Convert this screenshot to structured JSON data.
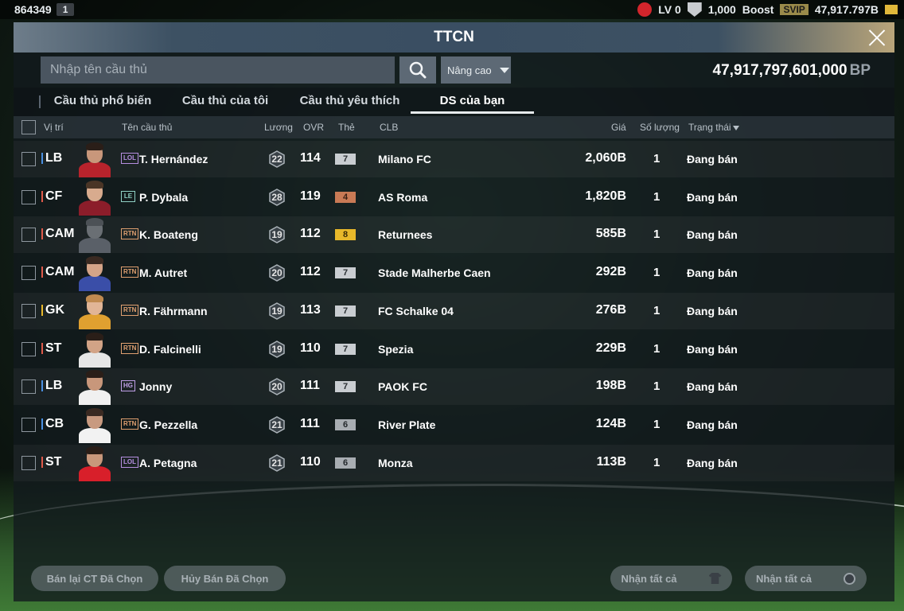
{
  "topbar": {
    "user_id": "864349",
    "badge": "1",
    "level": "LV 0",
    "trophy_value": "1,000",
    "boost_label": "Boost",
    "svip_label": "SVIP",
    "bp_short": "47,917.797B",
    "accent_red": "#d2252c",
    "coin_color": "#e0b83a"
  },
  "window": {
    "title": "TTCN"
  },
  "search": {
    "placeholder": "Nhập tên cầu thủ",
    "value": "",
    "advanced_label": "Nâng cao"
  },
  "balance": {
    "amount": "47,917,797,601,000",
    "unit": "BP"
  },
  "tabs": [
    {
      "label": "Cầu thủ phổ biến",
      "active": false
    },
    {
      "label": "Cầu thủ của tôi",
      "active": false
    },
    {
      "label": "Cầu thủ yêu thích",
      "active": false
    },
    {
      "label": "DS của bạn",
      "active": true
    }
  ],
  "table": {
    "headers": {
      "position": "Vị trí",
      "name": "Tên cầu thủ",
      "salary": "Lương",
      "ovr": "OVR",
      "grade": "Thẻ",
      "club": "CLB",
      "price": "Giá",
      "qty": "Số lượng",
      "status": "Trạng thái"
    },
    "rows": [
      {
        "pos": "LB",
        "pos_color": "#4a90e2",
        "season": "LOL",
        "season_color": "#b58ee0",
        "name": "T. Hernández",
        "salary": "22",
        "ovr": "114",
        "grade": "7",
        "grade_bg": "#c9cdd1",
        "grade_fg": "#2a2f33",
        "club": "Milano FC",
        "price": "2,060B",
        "qty": "1",
        "status": "Đang bán",
        "kit": "#b8232c",
        "skin": "#c8977b",
        "hair": "#2a1e18"
      },
      {
        "pos": "CF",
        "pos_color": "#e05a4a",
        "season": "LE",
        "season_color": "#8fd0c4",
        "name": "P. Dybala",
        "salary": "28",
        "ovr": "119",
        "grade": "4",
        "grade_bg": "#c97a55",
        "grade_fg": "#3b2014",
        "club": "AS Roma",
        "price": "1,820B",
        "qty": "1",
        "status": "Đang bán",
        "kit": "#8c1d2a",
        "skin": "#d8ab8e",
        "hair": "#4a3526"
      },
      {
        "pos": "CAM",
        "pos_color": "#e05a4a",
        "season": "RTN",
        "season_color": "#e0a070",
        "name": "K. Boateng",
        "salary": "19",
        "ovr": "112",
        "grade": "8",
        "grade_bg": "#e8b82a",
        "grade_fg": "#3a2a05",
        "club": "Returnees",
        "price": "585B",
        "qty": "1",
        "status": "Đang bán",
        "kit": "#5a6068",
        "skin": "#6a6f74",
        "hair": "#4c5156"
      },
      {
        "pos": "CAM",
        "pos_color": "#e05a4a",
        "season": "RTN",
        "season_color": "#e0a070",
        "name": "M. Autret",
        "salary": "20",
        "ovr": "112",
        "grade": "7",
        "grade_bg": "#c9cdd1",
        "grade_fg": "#2a2f33",
        "club": "Stade Malherbe Caen",
        "price": "292B",
        "qty": "1",
        "status": "Đang bán",
        "kit": "#3a4ea8",
        "skin": "#d4a488",
        "hair": "#3a2a22"
      },
      {
        "pos": "GK",
        "pos_color": "#e8b82a",
        "season": "RTN",
        "season_color": "#e0a070",
        "name": "R. Fährmann",
        "salary": "19",
        "ovr": "113",
        "grade": "7",
        "grade_bg": "#c9cdd1",
        "grade_fg": "#2a2f33",
        "club": "FC Schalke 04",
        "price": "276B",
        "qty": "1",
        "status": "Đang bán",
        "kit": "#e0a030",
        "skin": "#e1b596",
        "hair": "#c08a50"
      },
      {
        "pos": "ST",
        "pos_color": "#e05a4a",
        "season": "RTN",
        "season_color": "#e0a070",
        "name": "D. Falcinelli",
        "salary": "19",
        "ovr": "110",
        "grade": "7",
        "grade_bg": "#c9cdd1",
        "grade_fg": "#2a2f33",
        "club": "Spezia",
        "price": "229B",
        "qty": "1",
        "status": "Đang bán",
        "kit": "#e6e6e6",
        "skin": "#d2a386",
        "hair": "#2a1e18"
      },
      {
        "pos": "LB",
        "pos_color": "#4a90e2",
        "season": "HG",
        "season_color": "#c0a0e8",
        "name": "Jonny",
        "salary": "20",
        "ovr": "111",
        "grade": "7",
        "grade_bg": "#c9cdd1",
        "grade_fg": "#2a2f33",
        "club": "PAOK FC",
        "price": "198B",
        "qty": "1",
        "status": "Đang bán",
        "kit": "#f0f0f0",
        "skin": "#c8977b",
        "hair": "#2a1e18"
      },
      {
        "pos": "CB",
        "pos_color": "#4a90e2",
        "season": "RTN",
        "season_color": "#e0a070",
        "name": "G. Pezzella",
        "salary": "21",
        "ovr": "111",
        "grade": "6",
        "grade_bg": "#a8adb2",
        "grade_fg": "#23282c",
        "club": "River Plate",
        "price": "124B",
        "qty": "1",
        "status": "Đang bán",
        "kit": "#f2f2f2",
        "skin": "#c89a80",
        "hair": "#3a2a22"
      },
      {
        "pos": "ST",
        "pos_color": "#e05a4a",
        "season": "LOL",
        "season_color": "#b58ee0",
        "name": "A. Petagna",
        "salary": "21",
        "ovr": "110",
        "grade": "6",
        "grade_bg": "#a8adb2",
        "grade_fg": "#23282c",
        "club": "Monza",
        "price": "113B",
        "qty": "1",
        "status": "Đang bán",
        "kit": "#d81f2a",
        "skin": "#c8977b",
        "hair": "#2a1e18"
      }
    ]
  },
  "footer": {
    "resell_selected": "Bán lại CT Đã Chọn",
    "cancel_selected": "Hủy Bán Đã Chọn",
    "collect_all_players": "Nhận tất cả",
    "collect_all_bp": "Nhận tất cả"
  }
}
